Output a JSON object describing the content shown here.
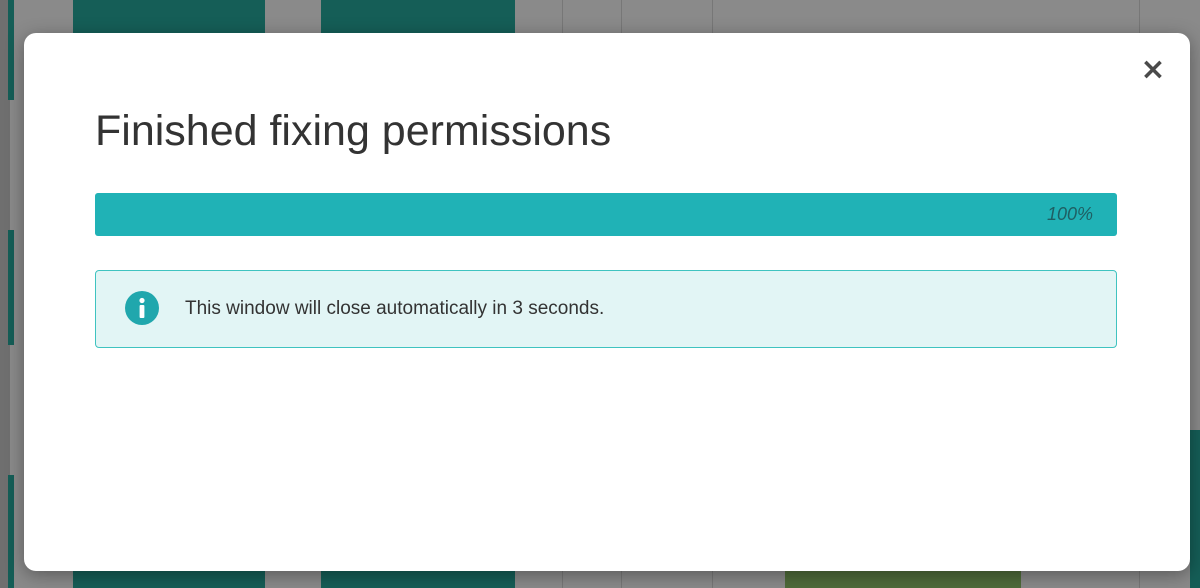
{
  "modal": {
    "title": "Finished fixing permissions",
    "close_symbol": "×",
    "progress": {
      "value": 100,
      "label": "100%"
    },
    "alert": {
      "icon": "info-circle-icon",
      "message": "This window will close automatically in 3 seconds."
    }
  },
  "colors": {
    "progress_bar": "#20b2b6",
    "alert_background": "#e2f5f5",
    "alert_border": "#3fc3c0",
    "info_icon": "#20a7ad"
  }
}
